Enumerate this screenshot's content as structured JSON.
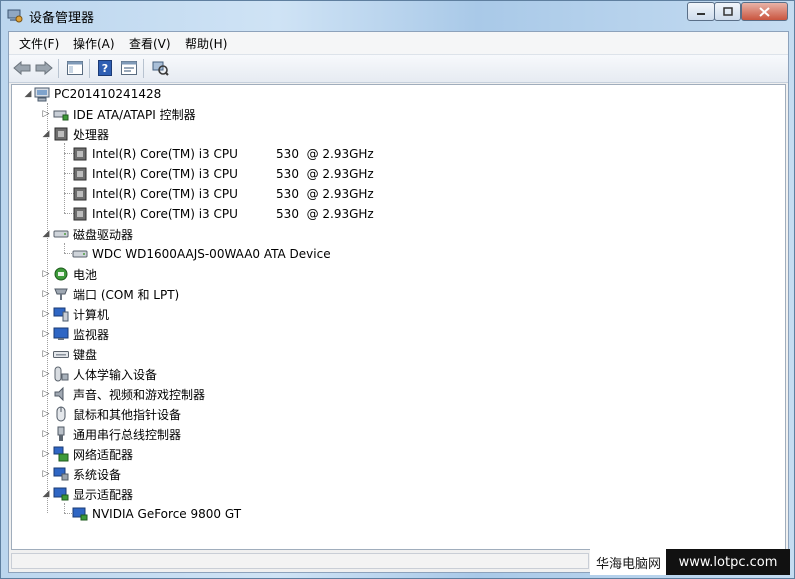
{
  "window": {
    "title": "设备管理器"
  },
  "menu": {
    "items": [
      "文件(F)",
      "操作(A)",
      "查看(V)",
      "帮助(H)"
    ]
  },
  "tree": {
    "root": "PC201410241428",
    "ide": "IDE ATA/ATAPI 控制器",
    "processors": "处理器",
    "cpu_1": "Intel(R) Core(TM) i3 CPU          530  @ 2.93GHz",
    "cpu_2": "Intel(R) Core(TM) i3 CPU          530  @ 2.93GHz",
    "cpu_3": "Intel(R) Core(TM) i3 CPU          530  @ 2.93GHz",
    "cpu_4": "Intel(R) Core(TM) i3 CPU          530  @ 2.93GHz",
    "disk_drives": "磁盘驱动器",
    "disk_1": "WDC WD1600AAJS-00WAA0 ATA Device",
    "battery": "电池",
    "ports": "端口 (COM 和 LPT)",
    "computer": "计算机",
    "monitors": "监视器",
    "keyboards": "键盘",
    "hid": "人体学输入设备",
    "sound": "声音、视频和游戏控制器",
    "mice": "鼠标和其他指针设备",
    "usb": "通用串行总线控制器",
    "network": "网络适配器",
    "system": "系统设备",
    "display": "显示适配器",
    "gpu_1": "NVIDIA GeForce 9800 GT"
  },
  "watermark": {
    "site_name": "华海电脑网",
    "url": "www.lotpc.com"
  }
}
